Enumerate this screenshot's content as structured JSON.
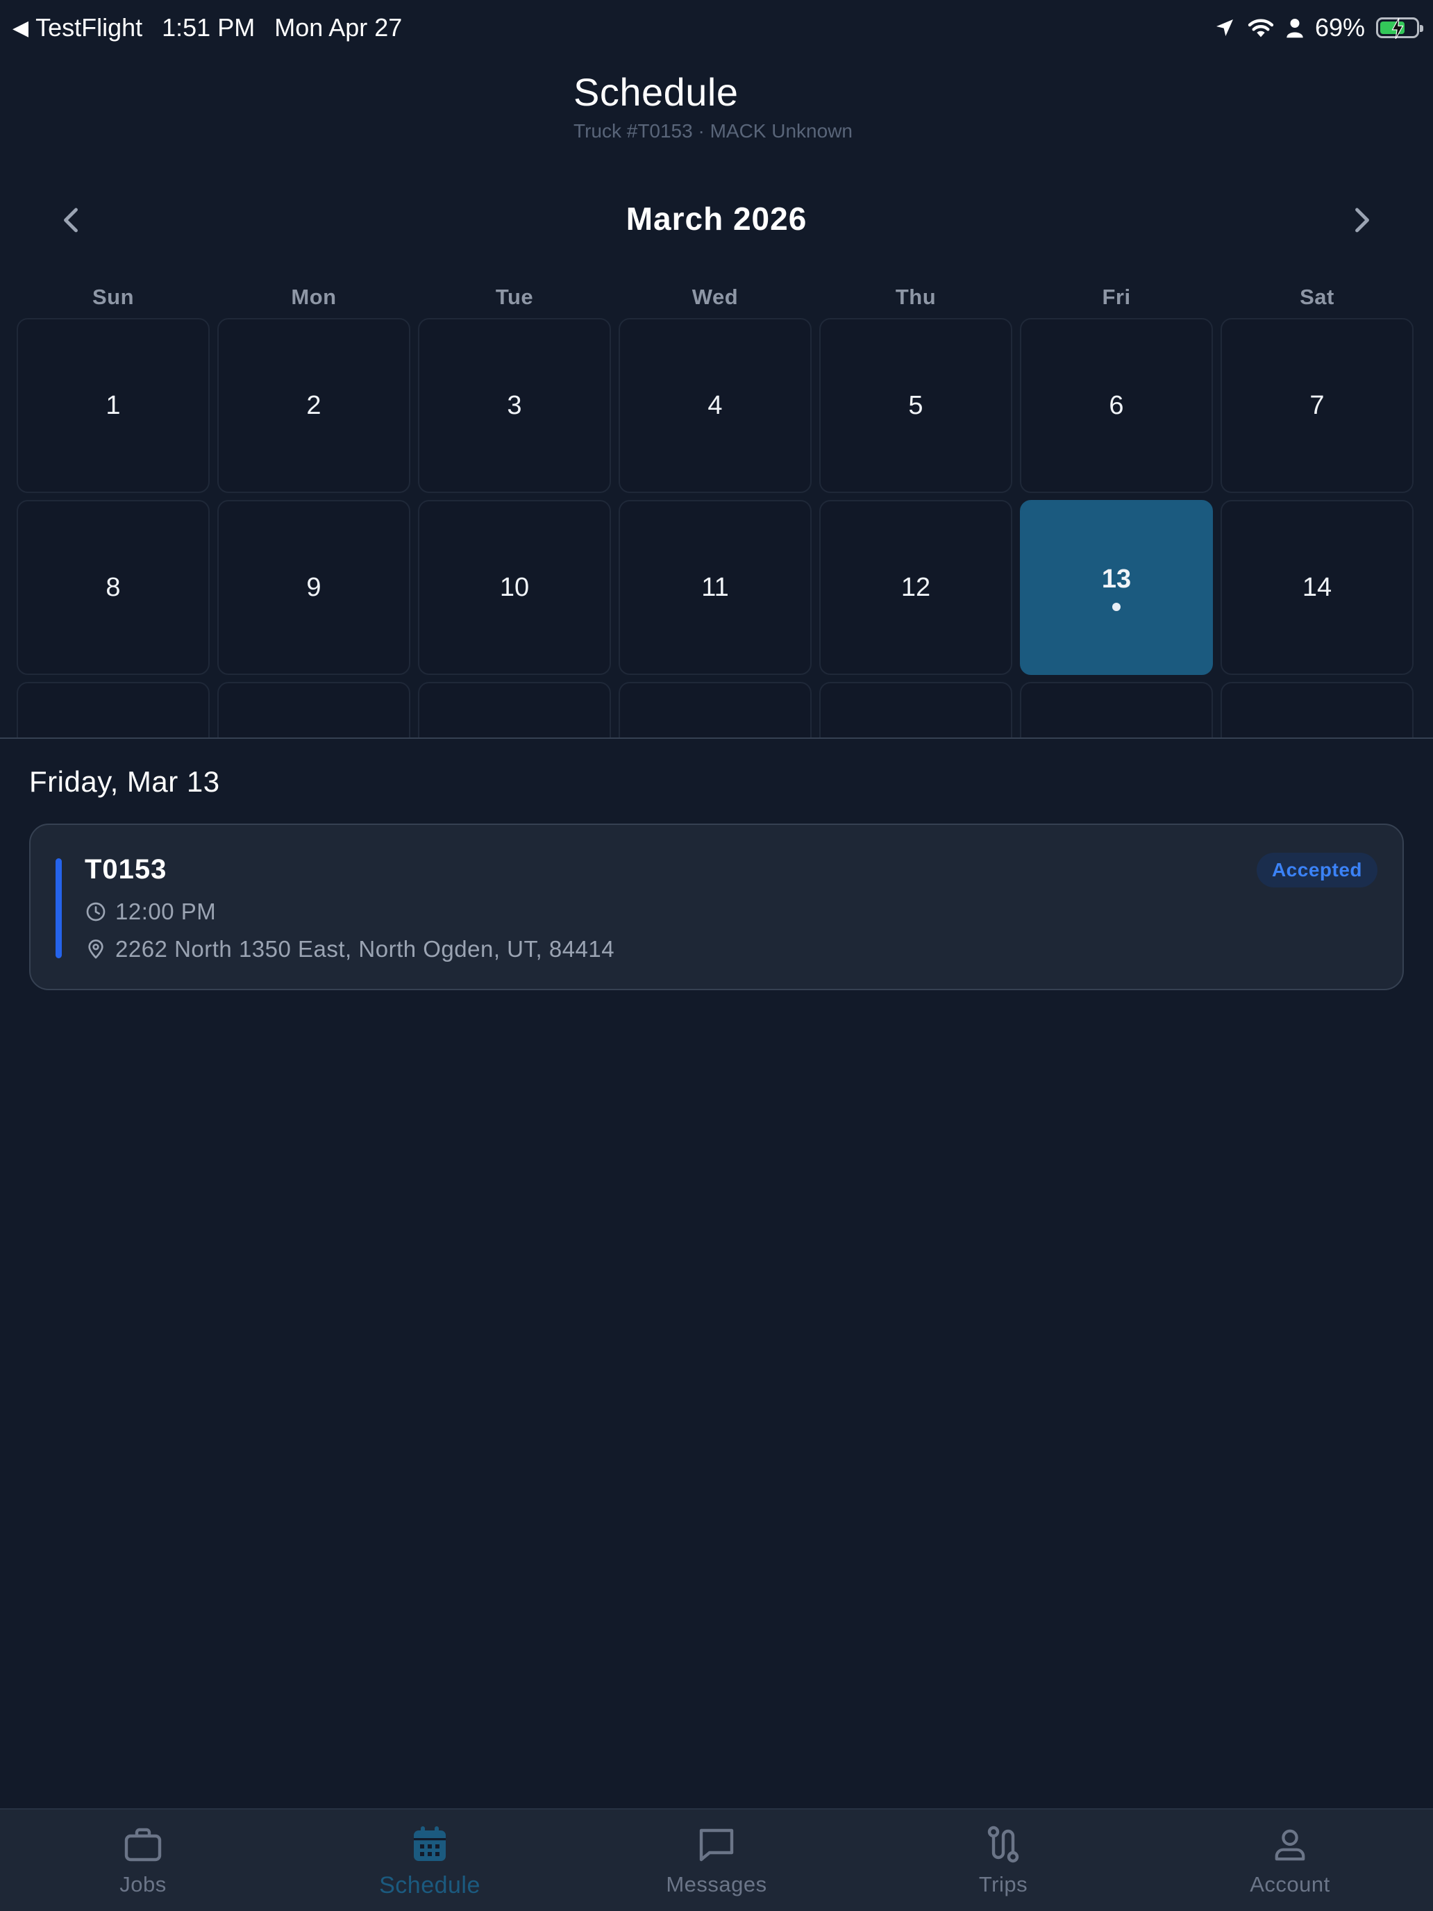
{
  "status_bar": {
    "back_app": "TestFlight",
    "time": "1:51 PM",
    "date": "Mon Apr 27",
    "battery": "69%",
    "battery_level": 0.69,
    "icons": [
      "location-arrow-icon",
      "wifi-icon",
      "person-icon",
      "battery-charging-icon"
    ]
  },
  "header": {
    "title": "Schedule",
    "subtitle": "Truck #T0153 · MACK Unknown"
  },
  "calendar": {
    "month_label": "March 2026",
    "weekdays": [
      "Sun",
      "Mon",
      "Tue",
      "Wed",
      "Thu",
      "Fri",
      "Sat"
    ],
    "weeks": [
      [
        "1",
        "2",
        "3",
        "4",
        "5",
        "6",
        "7"
      ],
      [
        "8",
        "9",
        "10",
        "11",
        "12",
        "13",
        "14"
      ],
      [
        "",
        "",
        "",
        "",
        "",
        "",
        ""
      ]
    ],
    "selected_day": "13",
    "days_with_events": [
      "13"
    ],
    "selected_color": "#1b5a7f"
  },
  "selected": {
    "date_label": "Friday, Mar 13",
    "jobs": [
      {
        "title": "T0153",
        "time": "12:00 PM",
        "address": "2262 North 1350 East, North Ogden, UT, 84414",
        "status": "Accepted",
        "accent_color": "#2563eb"
      }
    ]
  },
  "tabs": [
    {
      "label": "Jobs",
      "icon": "briefcase-icon",
      "active": false
    },
    {
      "label": "Schedule",
      "icon": "calendar-icon",
      "active": true
    },
    {
      "label": "Messages",
      "icon": "chat-bubble-icon",
      "active": false
    },
    {
      "label": "Trips",
      "icon": "route-icon",
      "active": false
    },
    {
      "label": "Account",
      "icon": "user-icon",
      "active": false
    }
  ]
}
